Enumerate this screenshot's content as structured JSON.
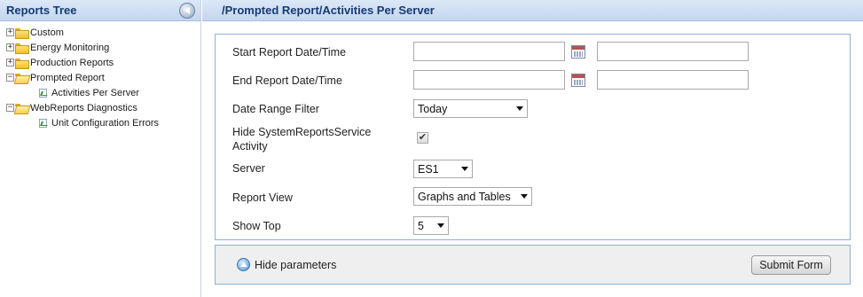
{
  "tree": {
    "title": "Reports Tree",
    "items": [
      {
        "label": "Custom",
        "expander": "+"
      },
      {
        "label": "Energy Monitoring",
        "expander": "+"
      },
      {
        "label": "Production Reports",
        "expander": "+"
      },
      {
        "label": "Prompted Report",
        "expander": "−"
      },
      {
        "label": "Activities Per Server"
      },
      {
        "label": "WebReports Diagnostics",
        "expander": "−"
      },
      {
        "label": "Unit Configuration Errors"
      }
    ]
  },
  "header": {
    "path": "/Prompted Report/Activities Per Server"
  },
  "params": {
    "start_label": "Start Report Date/Time",
    "start_date_value": "",
    "start_time_value": "",
    "end_label": "End Report Date/Time",
    "end_date_value": "",
    "end_time_value": "",
    "date_range_label": "Date Range Filter",
    "date_range_value": "Today",
    "hide_service_label_line1": "Hide SystemReportsService",
    "hide_service_label_line2": "Activity",
    "hide_service_checked": "✔",
    "server_label": "Server",
    "server_value": "ES1",
    "report_view_label": "Report View",
    "report_view_value": "Graphs and Tables",
    "show_top_label": "Show Top",
    "show_top_value": "5"
  },
  "footer": {
    "hide_params_label": "Hide parameters",
    "submit_label": "Submit Form"
  }
}
